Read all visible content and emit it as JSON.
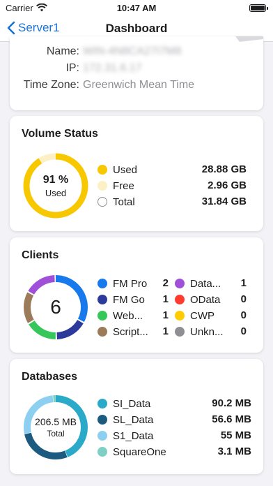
{
  "status_bar": {
    "carrier": "Carrier",
    "time": "10:47 AM"
  },
  "nav": {
    "back_label": "Server1",
    "title": "Dashboard"
  },
  "server_info": {
    "rows": [
      {
        "label": "Name:",
        "value": "WIN-4N8CA27I7M8",
        "obscured": true
      },
      {
        "label": "IP:",
        "value": "172.31.6.17",
        "obscured": true
      },
      {
        "label": "Time Zone:",
        "value": "Greenwich Mean Time",
        "obscured": false
      }
    ]
  },
  "volume_status": {
    "title": "Volume Status",
    "center_value": "91 %",
    "center_label": "Used",
    "used_fraction": 0.91,
    "legend": [
      {
        "label": "Used",
        "value": "28.88 GB",
        "color": "#f7c800"
      },
      {
        "label": "Free",
        "value": "2.96 GB",
        "color": "#fcf0c4"
      },
      {
        "label": "Total",
        "value": "31.84 GB",
        "color": "#ffffff"
      }
    ]
  },
  "clients": {
    "title": "Clients",
    "center_value": "6",
    "items": [
      {
        "label": "FM Pro",
        "count": "2",
        "color": "#1779ec"
      },
      {
        "label": "FM Go",
        "count": "1",
        "color": "#2c3a9c"
      },
      {
        "label": "Web...",
        "count": "1",
        "color": "#35c759"
      },
      {
        "label": "Script...",
        "count": "1",
        "color": "#9b7b5a"
      },
      {
        "label": "Data...",
        "count": "1",
        "color": "#a050d8"
      },
      {
        "label": "OData",
        "count": "0",
        "color": "#ff3b30"
      },
      {
        "label": "CWP",
        "count": "0",
        "color": "#ffcc00"
      },
      {
        "label": "Unkn...",
        "count": "0",
        "color": "#8e8e93"
      }
    ]
  },
  "databases": {
    "title": "Databases",
    "center_value": "206.5 MB",
    "center_label": "Total",
    "items": [
      {
        "label": "SI_Data",
        "value": "90.2 MB",
        "mb": 90.2,
        "color": "#2aa9c9"
      },
      {
        "label": "SL_Data",
        "value": "56.6 MB",
        "mb": 56.6,
        "color": "#1d5a80"
      },
      {
        "label": "S1_Data",
        "value": "55 MB",
        "mb": 55,
        "color": "#8dcff0"
      },
      {
        "label": "SquareOne",
        "value": "3.1 MB",
        "mb": 3.1,
        "color": "#7ed0c4"
      }
    ]
  }
}
